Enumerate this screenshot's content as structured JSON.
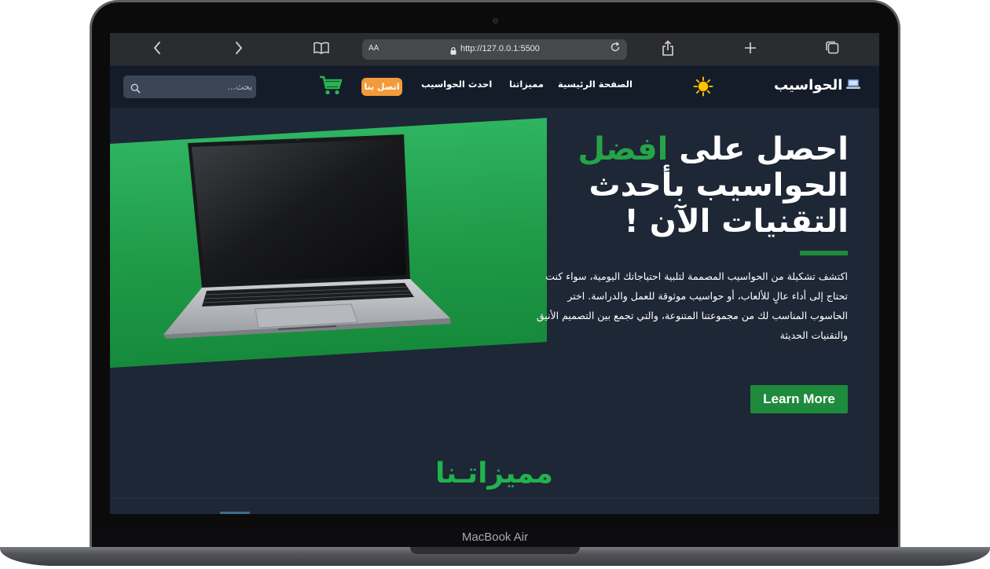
{
  "device": {
    "model_label": "MacBook Air"
  },
  "browser": {
    "text_size_label": "AA",
    "url": "http://127.0.0.1:5500",
    "icons": {
      "back": "chevron-left-icon",
      "forward": "chevron-right-icon",
      "reader": "book-icon",
      "lock": "lock-icon",
      "reload": "reload-icon",
      "share": "share-icon",
      "new_tab": "plus-icon",
      "tabs": "tabs-icon"
    }
  },
  "header": {
    "brand_name": "الحواسيب",
    "brand_icon": "laptop-icon",
    "theme_icon": "sun-icon",
    "nav": [
      {
        "label": "الصفحة الرئيسية"
      },
      {
        "label": "مميزاتنا"
      },
      {
        "label": "احدث الحواسيب"
      }
    ],
    "contact_label": "اتصل بنا",
    "cart_icon": "shopping-cart-icon",
    "search_placeholder": "بحث..."
  },
  "hero": {
    "title_part1": "احصل على ",
    "title_highlight": "افضل",
    "title_part2": " الحواسيب بأحدث التقنيات الآن !",
    "description": "اكتشف تشكيلة من الحواسيب المصممة لتلبية احتياجاتك اليومية، سواء كنت تحتاج إلى أداء عالٍ للألعاب، أو حواسيب موثوقة للعمل والدراسة. اختر الحاسوب المناسب لك من مجموعتنا المتنوعة، والتي تجمع بين التصميم الأنيق والتقنيات الحديثة",
    "cta_label": "Learn More",
    "image": "laptop-product-image"
  },
  "features": {
    "title": "مميزاتـنا"
  },
  "colors": {
    "page_bg": "#1e2736",
    "nav_bg": "#141c2a",
    "accent_green": "#26a348",
    "hero_green": "#22a24f",
    "contact_orange": "#f29b3a"
  }
}
